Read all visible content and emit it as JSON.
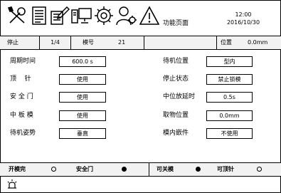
{
  "header": {
    "title": "功能页面",
    "time": "12:00",
    "date": "2016/10/30",
    "icons": [
      "tools-icon",
      "document-icon",
      "notes-icon",
      "monitor-icon",
      "settings-gear-icon",
      "user-icon",
      "warning-icon"
    ]
  },
  "status": {
    "state": "停止",
    "page": "1/4",
    "mold_label": "模号",
    "mold_value": "21",
    "position_label": "位置",
    "position_value": "0.0mm"
  },
  "params_left": [
    {
      "label": "周期时间",
      "value": "600.0 s"
    },
    {
      "label": "顶    针",
      "value": "使用"
    },
    {
      "label": "安 全 门",
      "value": "使用"
    },
    {
      "label": "中 板 模",
      "value": "使用"
    },
    {
      "label": "待机姿势",
      "value": "垂直"
    }
  ],
  "params_right": [
    {
      "label": "待机位置",
      "value": "型内"
    },
    {
      "label": "停止状态",
      "value": "禁止锁模"
    },
    {
      "label": "中位放延时",
      "value": "0.5s"
    },
    {
      "label": "取物位置",
      "value": "0.0mm"
    },
    {
      "label": "模内嵌件",
      "value": "不使用"
    }
  ],
  "signals": [
    {
      "label": "开模完",
      "on": false
    },
    {
      "label": "安全门",
      "on": true
    },
    {
      "label": "可关模",
      "on": true
    },
    {
      "label": "可顶针",
      "on": false
    }
  ],
  "footer": {
    "icon": "alarm-light-icon"
  }
}
